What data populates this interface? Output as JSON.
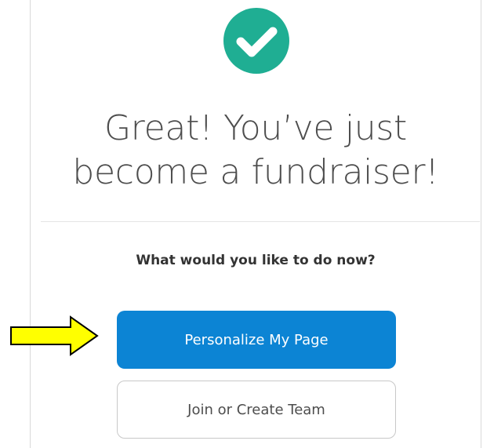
{
  "success": {
    "icon": "check-circle-icon",
    "color": "#1fae93"
  },
  "headline": {
    "line1": "Great! You’ve just",
    "line2": "become a fundraiser!"
  },
  "prompt": "What would you like to do now?",
  "actions": {
    "primary_label": "Personalize My Page",
    "secondary_label": "Join or Create Team",
    "primary_color": "#0c84d4"
  },
  "annotation": {
    "icon": "right-arrow-icon",
    "color": "#ffff00"
  }
}
